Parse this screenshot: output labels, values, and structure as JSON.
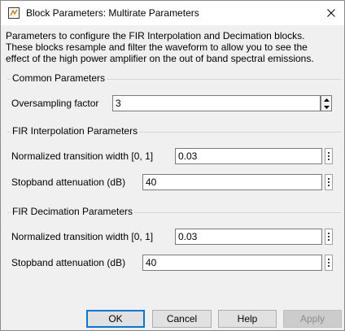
{
  "window": {
    "title": "Block Parameters: Multirate Parameters",
    "description": "Parameters to configure the FIR Interpolation and Decimation blocks.\nThese blocks resample and filter the waveform to allow you to see the\neffect of the high power amplifier on the out of band spectral emissions."
  },
  "common": {
    "title": "Common Parameters",
    "oversampling_label": "Oversampling factor",
    "oversampling_value": "3"
  },
  "interp": {
    "title": "FIR Interpolation Parameters",
    "transition_label": "Normalized transition width [0, 1]",
    "transition_value": "0.03",
    "stopband_label": "Stopband attenuation (dB)",
    "stopband_value": "40"
  },
  "decim": {
    "title": "FIR Decimation Parameters",
    "transition_label": "Normalized transition width [0, 1]",
    "transition_value": "0.03",
    "stopband_label": "Stopband attenuation (dB)",
    "stopband_value": "40"
  },
  "buttons": {
    "ok": "OK",
    "cancel": "Cancel",
    "help": "Help",
    "apply": "Apply"
  },
  "icons": {
    "app": "simulink-block-icon",
    "close": "close-icon",
    "more": "more-options-icon",
    "spin_up": "spin-up-icon",
    "spin_down": "spin-down-icon"
  },
  "colors": {
    "default_button_border": "#0078d7",
    "disabled_text": "#8d8d8d"
  }
}
